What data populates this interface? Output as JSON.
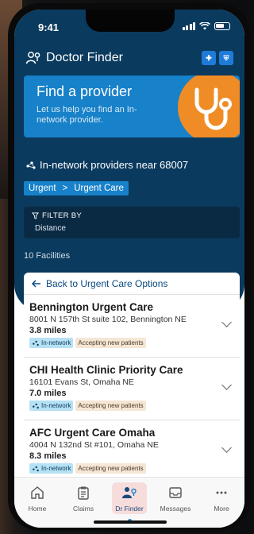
{
  "status": {
    "time": "9:41"
  },
  "header": {
    "title": "Doctor Finder",
    "logo_left": "✚",
    "logo_right": "⛨"
  },
  "hero": {
    "title": "Find a provider",
    "subtitle": "Let us help you find an In-network provider."
  },
  "near": {
    "label": "In-network providers near 68007"
  },
  "breadcrumbs": {
    "parent": "Urgent",
    "separator": ">",
    "current": "Urgent Care"
  },
  "filter": {
    "title": "FILTER BY",
    "value": "Distance"
  },
  "count": {
    "label": "10 Facilities"
  },
  "list": {
    "back_label": "Back to Urgent Care Options",
    "facilities": [
      {
        "name": "Bennington Urgent Care",
        "address": "8001 N 157th St suite 102, Bennington NE",
        "distance": "3.8 miles",
        "network": "In-network",
        "status": "Accepting new patients"
      },
      {
        "name": "CHI Health Clinic Priority Care",
        "address": "16101 Evans St, Omaha NE",
        "distance": "7.0 miles",
        "network": "In-network",
        "status": "Accepting new patients"
      },
      {
        "name": "AFC Urgent Care Omaha",
        "address": "4004 N 132nd St #101, Omaha NE",
        "distance": "8.3 miles",
        "network": "In-network",
        "status": "Accepting new patients"
      }
    ]
  },
  "tabs": [
    {
      "label": "Home",
      "icon": "home-icon"
    },
    {
      "label": "Claims",
      "icon": "clipboard-icon"
    },
    {
      "label": "Dr Finder",
      "icon": "doctor-search-icon",
      "active": true
    },
    {
      "label": "Messages",
      "icon": "inbox-icon"
    },
    {
      "label": "More",
      "icon": "more-icon"
    }
  ],
  "colors": {
    "navy": "#0a3a5e",
    "accent_blue": "#1781c9",
    "orange": "#f08c26"
  }
}
